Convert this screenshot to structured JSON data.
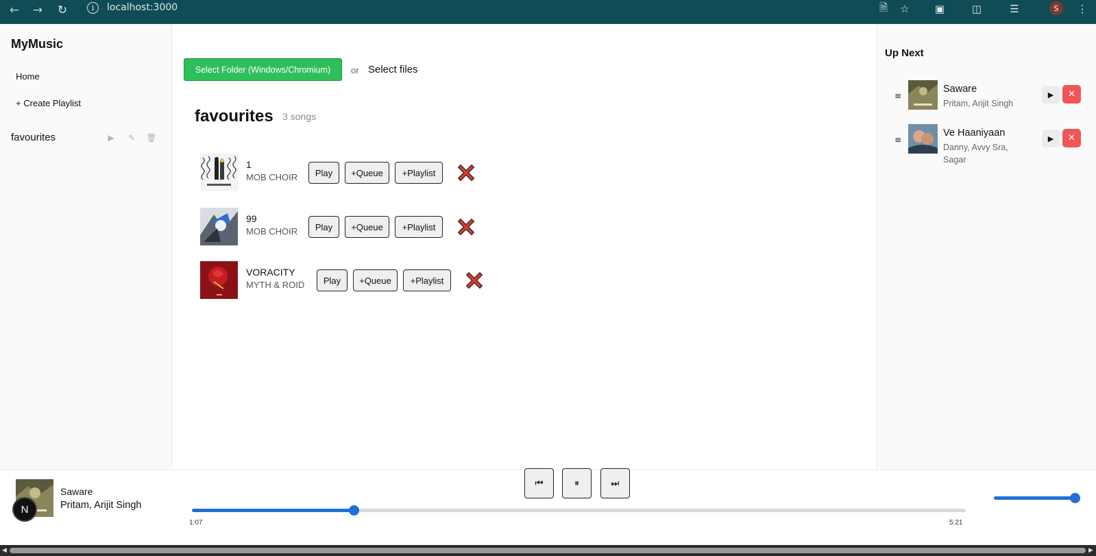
{
  "browser": {
    "url": "localhost:3000",
    "profile_initial": "S"
  },
  "sidebar": {
    "brand": "MyMusic",
    "home_label": "Home",
    "create_label": "+ Create Playlist",
    "playlists": [
      {
        "name": "favourites"
      }
    ]
  },
  "main": {
    "select_folder_label": "Select Folder (Windows/Chromium)",
    "or_label": "or",
    "select_files_label": "Select files",
    "playlist_title": "favourites",
    "song_count": "3 songs",
    "songs": [
      {
        "title": "1",
        "artist": "MOB CHOIR"
      },
      {
        "title": "99",
        "artist": "MOB CHOIR"
      },
      {
        "title": "VORACITY",
        "artist": "MYTH & ROID"
      }
    ],
    "play_label": "Play",
    "queue_label": "+Queue",
    "playlist_label": "+Playlist"
  },
  "upnext": {
    "title": "Up Next",
    "items": [
      {
        "title": "Saware",
        "artist": "Pritam, Arijit Singh"
      },
      {
        "title": "Ve Haaniyaan",
        "artist": "Danny, Avvy Sra, Sagar"
      }
    ]
  },
  "player": {
    "title": "Saware",
    "artist": "Pritam, Arijit Singh",
    "current_time": "1:07",
    "duration": "5:21",
    "progress_fraction": 0.209,
    "volume_fraction": 1.0,
    "badge": "N"
  },
  "colors": {
    "chrome": "#0f4c55",
    "accent": "#1f6fd6",
    "green_button": "#2fbf5a",
    "remove_red": "#f25555",
    "x_red": "#e03a2e"
  }
}
